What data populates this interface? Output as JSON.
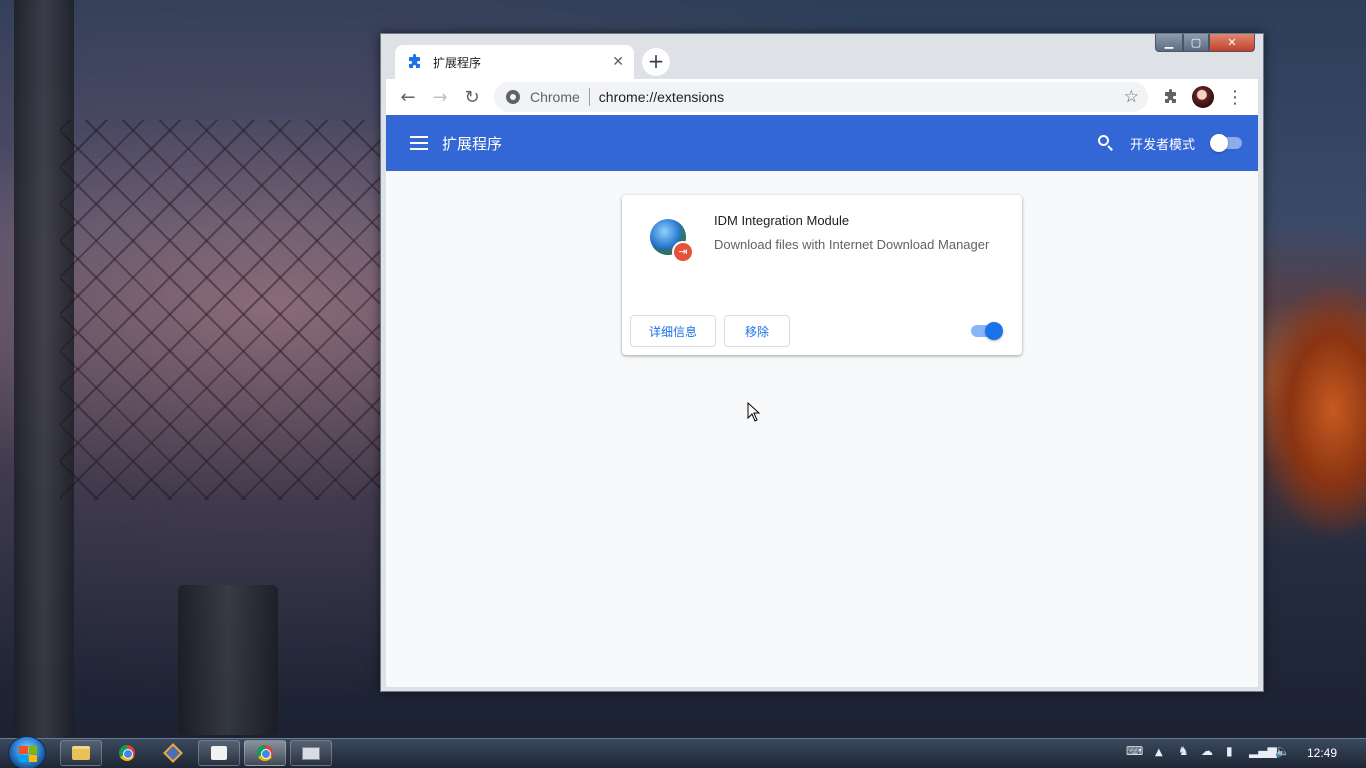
{
  "window": {
    "controls": {
      "minimize": "▁",
      "maximize": "▢",
      "close": "✕"
    }
  },
  "tab": {
    "title": "扩展程序",
    "close_glyph": "✕",
    "new_tab_glyph": "+"
  },
  "toolbar": {
    "back_glyph": "←",
    "forward_glyph": "→",
    "reload_glyph": "↻",
    "omnibox_chip": "Chrome",
    "url": "chrome://extensions",
    "star_glyph": "☆",
    "menu_glyph": "⋮"
  },
  "header": {
    "title": "扩展程序",
    "developer_mode_label": "开发者模式",
    "developer_mode_on": false
  },
  "extension": {
    "name": "IDM Integration Module",
    "description": "Download files with Internet Download Manager",
    "details_button": "详细信息",
    "remove_button": "移除",
    "enabled": true,
    "badge_glyph": "⇥"
  },
  "taskbar": {
    "clock": "12:49",
    "apps": [
      "file-explorer",
      "chrome",
      "app",
      "text-editor",
      "chrome-active",
      "remote-desktop"
    ]
  },
  "colors": {
    "header_blue": "#3367d6",
    "accent": "#1a73e8",
    "page_bg": "#f8f9fa"
  }
}
